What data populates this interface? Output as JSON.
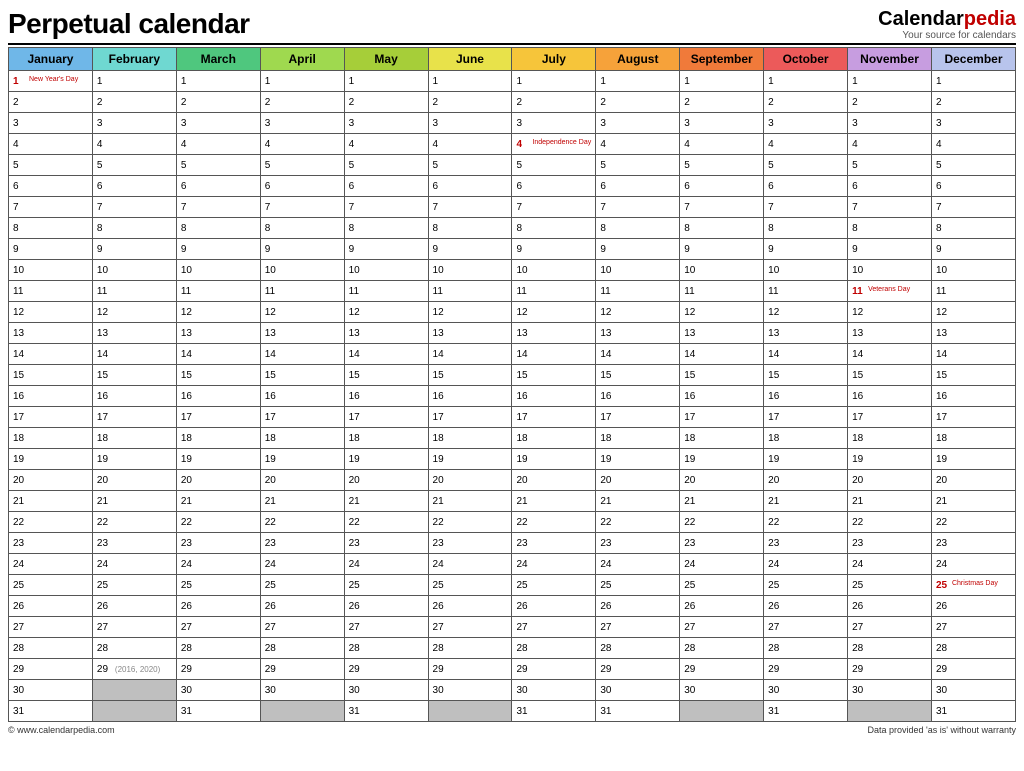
{
  "header": {
    "title": "Perpetual calendar",
    "brand_main": "Calendar",
    "brand_accent": "pedia",
    "brand_tag": "Your source for calendars"
  },
  "months": [
    {
      "name": "January",
      "color": "#6fb7e8",
      "days": 31
    },
    {
      "name": "February",
      "color": "#6fd8d1",
      "days": 29
    },
    {
      "name": "March",
      "color": "#4fc77e",
      "days": 31
    },
    {
      "name": "April",
      "color": "#9fd94f",
      "days": 30
    },
    {
      "name": "May",
      "color": "#a6ce39",
      "days": 31
    },
    {
      "name": "June",
      "color": "#e8e24a",
      "days": 30
    },
    {
      "name": "July",
      "color": "#f6c53a",
      "days": 31
    },
    {
      "name": "August",
      "color": "#f6a23a",
      "days": 31
    },
    {
      "name": "September",
      "color": "#f07a3a",
      "days": 30
    },
    {
      "name": "October",
      "color": "#ec5a5a",
      "days": 31
    },
    {
      "name": "November",
      "color": "#c79de0",
      "days": 30
    },
    {
      "name": "December",
      "color": "#b8c4ec",
      "days": 31
    }
  ],
  "holidays": {
    "0": {
      "1": "New Year's Day"
    },
    "6": {
      "4": "Independence Day"
    },
    "10": {
      "11": "Veterans Day"
    },
    "11": {
      "25": "Christmas Day"
    }
  },
  "leap_note": {
    "month_index": 1,
    "day": 29,
    "text": "(2016, 2020)"
  },
  "footer": {
    "left": "© www.calendarpedia.com",
    "right": "Data provided 'as is' without warranty"
  },
  "chart_data": {
    "type": "table",
    "title": "Perpetual calendar",
    "columns": [
      "January",
      "February",
      "March",
      "April",
      "May",
      "June",
      "July",
      "August",
      "September",
      "October",
      "November",
      "December"
    ],
    "month_lengths": [
      31,
      29,
      31,
      30,
      31,
      30,
      31,
      31,
      30,
      31,
      30,
      31
    ],
    "holidays": [
      {
        "month": "January",
        "day": 1,
        "name": "New Year's Day"
      },
      {
        "month": "July",
        "day": 4,
        "name": "Independence Day"
      },
      {
        "month": "November",
        "day": 11,
        "name": "Veterans Day"
      },
      {
        "month": "December",
        "day": 25,
        "name": "Christmas Day"
      }
    ],
    "leap_day_note": {
      "month": "February",
      "day": 29,
      "years": [
        2016,
        2020
      ]
    }
  }
}
